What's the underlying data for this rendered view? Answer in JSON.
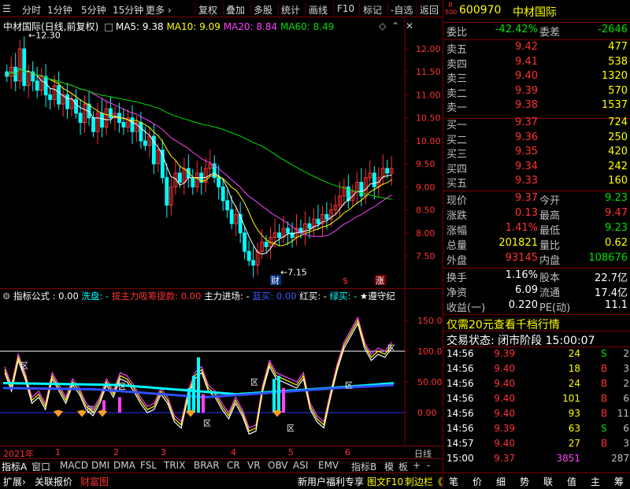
{
  "toolbar": {
    "items": [
      "分时",
      "1分钟",
      "5分钟",
      "15分钟",
      "更多 ›",
      "复权",
      "叠加",
      "多股",
      "统计",
      "画线",
      "F10",
      "标记",
      "-自选",
      "返回"
    ]
  },
  "main_chart": {
    "title": "中材国际(日线,前复权)",
    "ma5": "MA5: 9.38",
    "ma10": "MA10: 9.09",
    "ma20": "MA20: 8.84",
    "ma60": "MA60: 8.49",
    "high_label": "12.30",
    "low_label": "7.15",
    "y_ticks": [
      "12.00",
      "11.50",
      "11.00",
      "10.50",
      "10.00",
      "9.50",
      "9.00",
      "8.50",
      "8.00",
      "7.50"
    ],
    "marker_cai": "财",
    "marker_s": "$",
    "marker_zhang": "涨"
  },
  "indicator": {
    "header": "指标公式 : 0.00",
    "xipan": "洗盘: -",
    "zhuli": "拔主力吸筹提款: 0.00",
    "jinchang": "主力进场: -",
    "lanmai": "蓝买: 0.00",
    "hongmai": "红买: -",
    "lvmai": "绿买: -",
    "zunshou": "★遵守纪",
    "y_ticks": [
      "150.00",
      "100.00",
      "50.00",
      "0.00"
    ],
    "qu": "区"
  },
  "xaxis": {
    "year": "2021年",
    "months": [
      "1",
      "2",
      "3",
      "4",
      "5",
      "6"
    ],
    "period": "日线"
  },
  "tabs": [
    "指标A",
    "窗口",
    "MACD",
    "DMI",
    "DMA",
    "FSL",
    "TRIX",
    "BRAR",
    "CR",
    "VR",
    "OBV",
    "ASI",
    "EMV",
    "指标B",
    "模",
    "板",
    "+",
    "-"
  ],
  "bottom_bar": {
    "left": [
      "扩展›",
      "关联报价",
      "财富图"
    ],
    "center": "新用户福利专享",
    "right": [
      "图文F10",
      "刺边栏《"
    ],
    "icons": [
      "笔",
      "价",
      "细",
      "势",
      "联",
      "值",
      "主",
      "筹"
    ]
  },
  "quote": {
    "code": "600970",
    "name": "中材国际",
    "badge_top": "R",
    "badge_bottom": "500",
    "weibi_label": "委比",
    "weibi": "-42.42%",
    "weicha_label": "委差",
    "weicha": "-2646",
    "sells": [
      {
        "label": "卖五",
        "price": "9.42",
        "vol": "477"
      },
      {
        "label": "卖四",
        "price": "9.41",
        "vol": "538"
      },
      {
        "label": "卖三",
        "price": "9.40",
        "vol": "1320"
      },
      {
        "label": "卖二",
        "price": "9.39",
        "vol": "570"
      },
      {
        "label": "卖一",
        "price": "9.38",
        "vol": "1537"
      }
    ],
    "buys": [
      {
        "label": "买一",
        "price": "9.37",
        "vol": "724"
      },
      {
        "label": "买二",
        "price": "9.36",
        "vol": "250"
      },
      {
        "label": "买三",
        "price": "9.35",
        "vol": "420"
      },
      {
        "label": "买四",
        "price": "9.34",
        "vol": "242"
      },
      {
        "label": "买五",
        "price": "9.33",
        "vol": "160"
      }
    ],
    "stats": [
      {
        "l1": "现价",
        "v1": "9.37",
        "l2": "今开",
        "v2": "9.23"
      },
      {
        "l1": "涨跌",
        "v1": "0.13",
        "l2": "最高",
        "v2": "9.47"
      },
      {
        "l1": "涨幅",
        "v1": "1.41%",
        "l2": "最低",
        "v2": "9.23"
      },
      {
        "l1": "总量",
        "v1": "201821",
        "l2": "量比",
        "v2": "0.62"
      },
      {
        "l1": "外盘",
        "v1": "93145",
        "l2": "内盘",
        "v2": "108676"
      }
    ],
    "stats2": [
      {
        "l1": "换手",
        "v1": "1.16%",
        "l2": "股本",
        "v2": "22.7亿"
      },
      {
        "l1": "净资",
        "v1": "6.09",
        "l2": "流通",
        "v2": "17.4亿"
      },
      {
        "l1": "收益(一)",
        "v1": "0.220",
        "l2": "PE(动)",
        "v2": "11.1"
      }
    ],
    "promo": "仅需20元查看千档行情",
    "status": "交易状态: 闭市阶段 15:00:07",
    "ticks": [
      {
        "t": "14:56",
        "p": "9.39",
        "v": "24",
        "d": "S",
        "n": "2"
      },
      {
        "t": "14:56",
        "p": "9.40",
        "v": "18",
        "d": "B",
        "n": "3"
      },
      {
        "t": "14:56",
        "p": "9.40",
        "v": "24",
        "d": "B",
        "n": "2"
      },
      {
        "t": "14:56",
        "p": "9.40",
        "v": "101",
        "d": "B",
        "n": "6"
      },
      {
        "t": "14:56",
        "p": "9.40",
        "v": "93",
        "d": "B",
        "n": "11"
      },
      {
        "t": "14:56",
        "p": "9.39",
        "v": "63",
        "d": "S",
        "n": "6"
      },
      {
        "t": "14:57",
        "p": "9.40",
        "v": "27",
        "d": "B",
        "n": "3"
      },
      {
        "t": "15:00",
        "p": "9.37",
        "v": "3851",
        "d": "",
        "n": "287"
      }
    ]
  },
  "colors": {
    "up": "#ff3232",
    "down": "#00e000",
    "accent": "#ffff00",
    "ma5": "#ffffff",
    "ma10": "#ffff00",
    "ma20": "#ff40ff",
    "ma60": "#00e000"
  }
}
